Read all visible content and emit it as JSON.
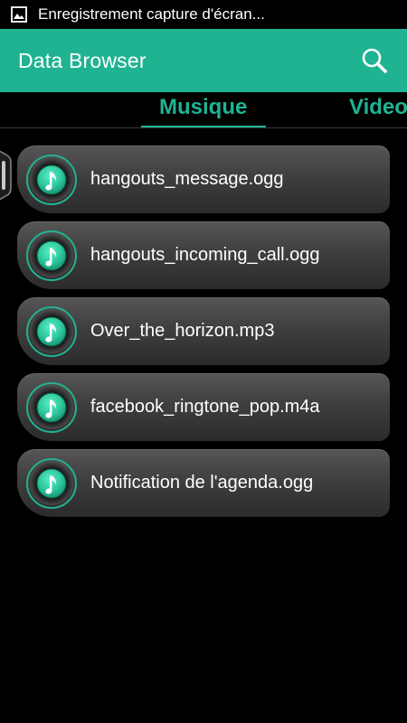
{
  "status_bar": {
    "notification": "Enregistrement capture d'écran..."
  },
  "app_bar": {
    "title": "Data Browser",
    "search_icon": "search-icon"
  },
  "tabs": [
    {
      "label": "Musique",
      "selected": true
    },
    {
      "label": "Video",
      "selected": false
    }
  ],
  "files": [
    {
      "name": "hangouts_message.ogg",
      "icon": "music-note-icon"
    },
    {
      "name": "hangouts_incoming_call.ogg",
      "icon": "music-note-icon"
    },
    {
      "name": "Over_the_horizon.mp3",
      "icon": "music-note-icon"
    },
    {
      "name": "facebook_ringtone_pop.m4a",
      "icon": "music-note-icon"
    },
    {
      "name": "Notification de l'agenda.ogg",
      "icon": "music-note-icon"
    }
  ],
  "colors": {
    "accent": "#20b392",
    "background": "#000000",
    "item": "#3f3f3f"
  }
}
